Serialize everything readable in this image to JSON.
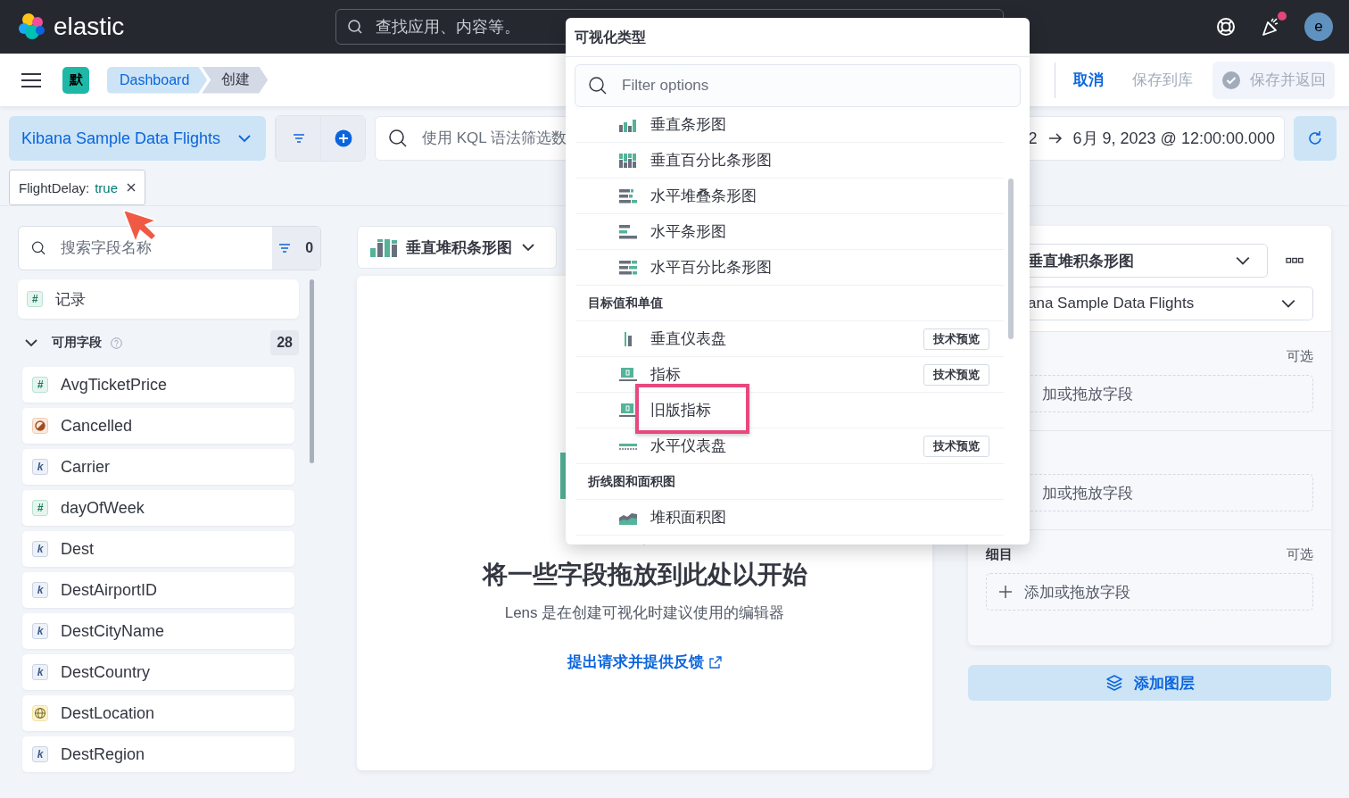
{
  "header": {
    "brand": "elastic",
    "search": {
      "placeholder": "查找应用、内容等。"
    },
    "notifications": {
      "unread": true
    },
    "avatar": "e"
  },
  "toolbar": {
    "space": "默",
    "breadcrumbs": [
      {
        "label": "Dashboard",
        "selected": false
      },
      {
        "label": "创建",
        "selected": true
      }
    ],
    "actions": [
      {
        "label": "取消",
        "kind": "link",
        "disabled": false
      },
      {
        "label": "保存到库",
        "kind": "link",
        "disabled": true
      },
      {
        "label": "保存并返回",
        "kind": "button",
        "disabled": true
      }
    ]
  },
  "query_bar": {
    "data_view": "Kibana Sample Data Flights",
    "query": {
      "placeholder": "使用 KQL 语法筛选数"
    },
    "time_start": "2",
    "time_end": "6月 9, 2023 @ 12:00:00.000"
  },
  "filters": [
    {
      "field": "FlightDelay:",
      "value": "true"
    }
  ],
  "field_list": {
    "search": {
      "placeholder": "搜索字段名称"
    },
    "filter_count": "0",
    "records": {
      "badge": "#",
      "name": "记录"
    },
    "section": {
      "title": "可用字段",
      "expanded": true,
      "count": "28"
    },
    "fields": [
      {
        "name": "AvgTicketPrice",
        "kind": "number",
        "badge": "#"
      },
      {
        "name": "Cancelled",
        "kind": "boolean"
      },
      {
        "name": "Carrier",
        "kind": "keyword",
        "badge": "k"
      },
      {
        "name": "dayOfWeek",
        "kind": "number",
        "badge": "#"
      },
      {
        "name": "Dest",
        "kind": "keyword",
        "badge": "k"
      },
      {
        "name": "DestAirportID",
        "kind": "keyword",
        "badge": "k"
      },
      {
        "name": "DestCityName",
        "kind": "keyword",
        "badge": "k"
      },
      {
        "name": "DestCountry",
        "kind": "keyword",
        "badge": "k"
      },
      {
        "name": "DestLocation",
        "kind": "geo"
      },
      {
        "name": "DestRegion",
        "kind": "keyword",
        "badge": "k"
      }
    ]
  },
  "workspace": {
    "chart_type": "垂直堆积条形图",
    "title": "将一些字段拖放到此处以开始",
    "subtitle": "Lens 是在创建可视化时建议使用的编辑器",
    "link": "提出请求并提供反馈"
  },
  "layer_panel": {
    "chart_type": "垂直堆积条形图",
    "data_view": "ana Sample Data Flights",
    "sections": [
      {
        "optional": "可选",
        "dropzone": "加或拖放字段",
        "plus": false
      },
      {
        "dropzone": "加或拖放字段",
        "plus": false
      },
      {
        "label": "细目",
        "optional": "可选",
        "dropzone": "添加或拖放字段",
        "plus": true
      }
    ],
    "add_layer": "添加图层"
  },
  "popover": {
    "title": "可视化类型",
    "search": {
      "placeholder": "Filter options"
    },
    "items": [
      {
        "kind": "vbar",
        "label": "垂直条形图"
      },
      {
        "kind": "vpercent",
        "label": "垂直百分比条形图"
      },
      {
        "kind": "hstack",
        "label": "水平堆叠条形图"
      },
      {
        "kind": "hbar",
        "label": "水平条形图"
      },
      {
        "kind": "hpercent",
        "label": "水平百分比条形图"
      },
      {
        "kind": "group",
        "label": "目标值和单值"
      },
      {
        "kind": "vgauge",
        "label": "垂直仪表盘",
        "badge": "技术预览"
      },
      {
        "kind": "metric",
        "label": "指标",
        "badge": "技术预览"
      },
      {
        "kind": "metric",
        "label": "旧版指标",
        "highlighted": true
      },
      {
        "kind": "hgauge",
        "label": "水平仪表盘",
        "badge": "技术预览"
      },
      {
        "kind": "group",
        "label": "折线图和面积图"
      },
      {
        "kind": "area",
        "label": "堆积面积图"
      }
    ]
  }
}
